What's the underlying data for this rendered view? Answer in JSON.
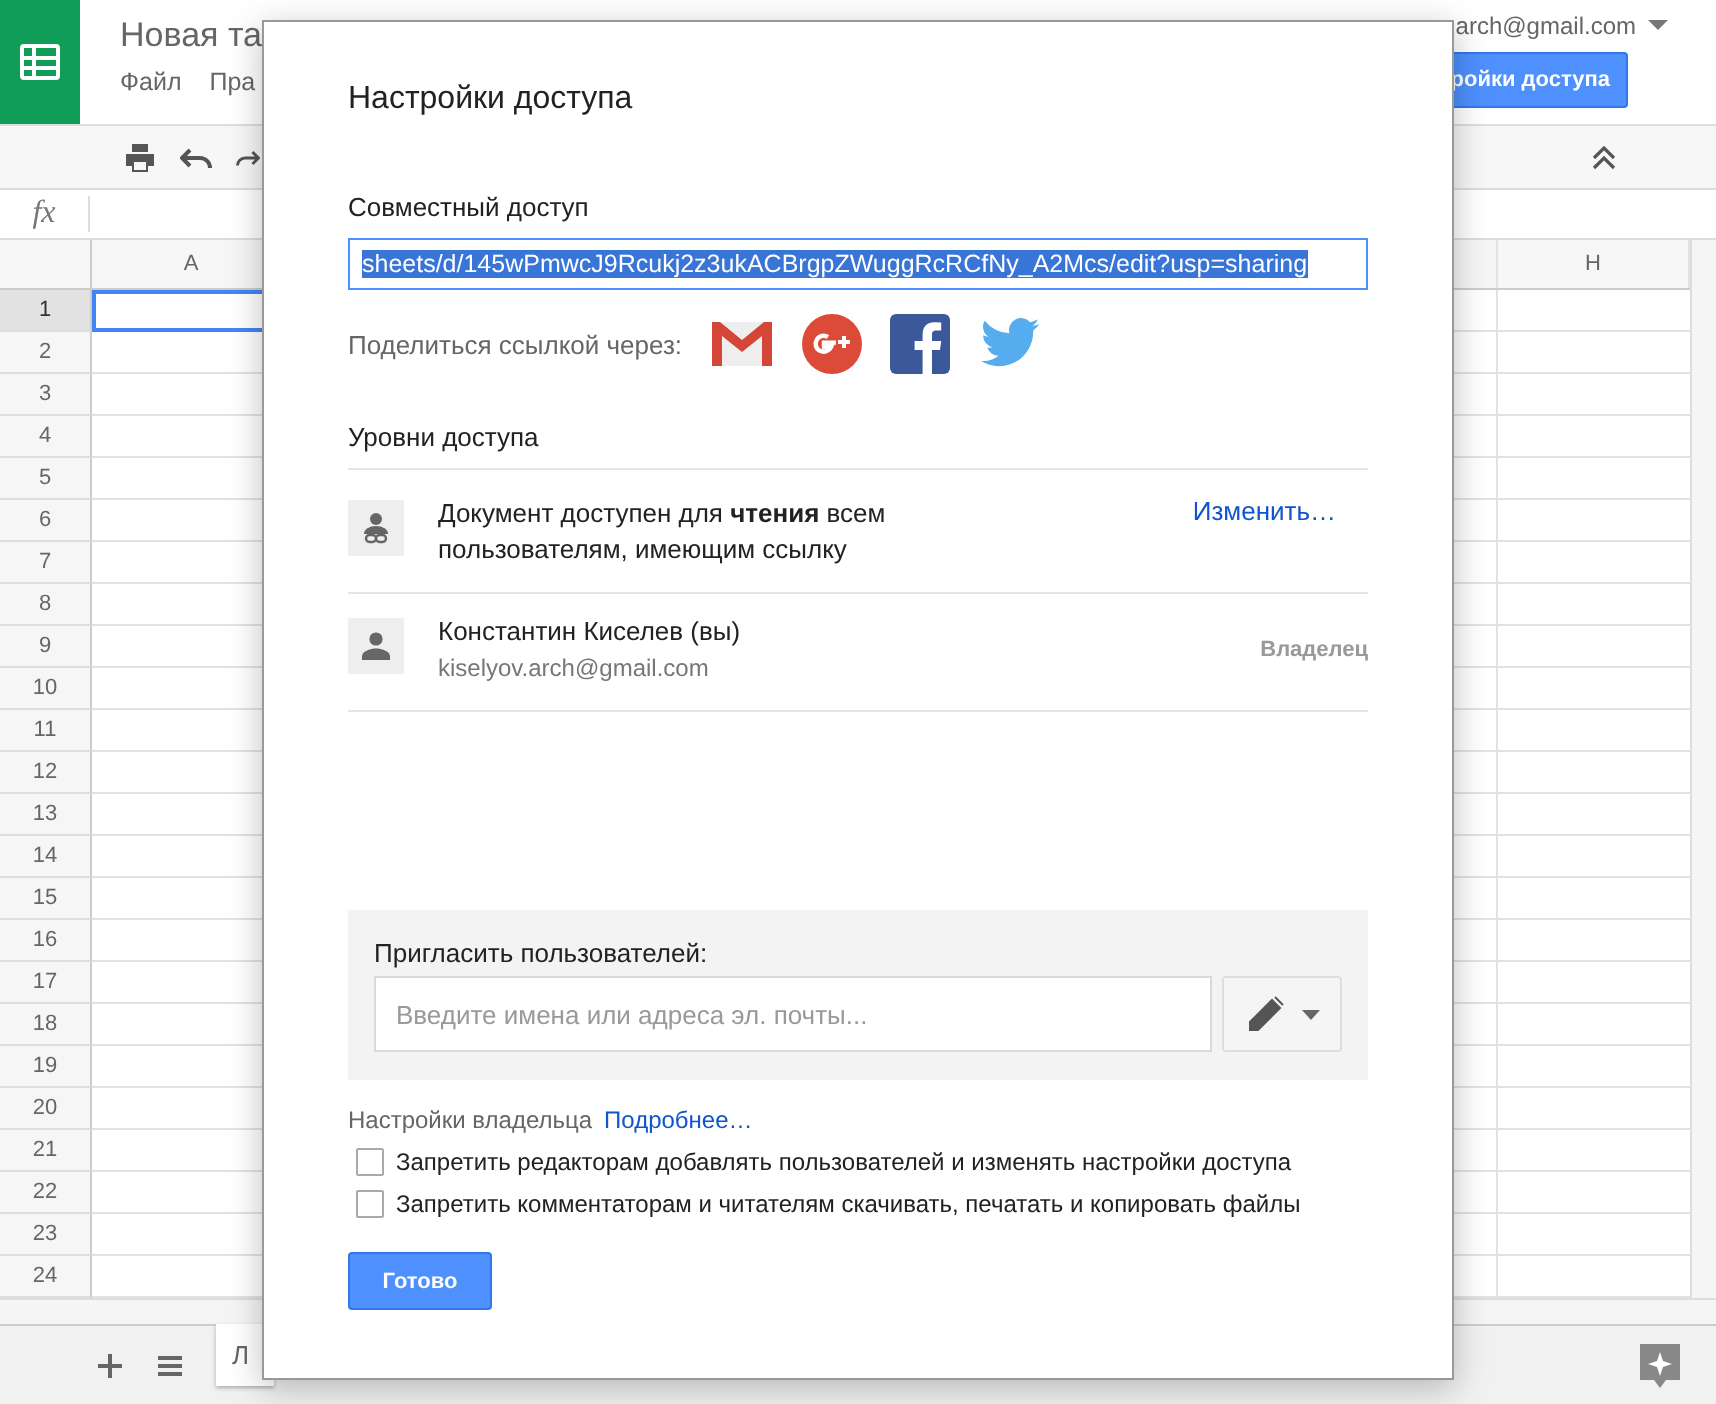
{
  "app": {
    "doc_title": "Новая та",
    "menu": [
      "Файл",
      "Пра"
    ],
    "account": "arch@gmail.com",
    "share_button": "ройки доступа",
    "formula_label": "fx",
    "columns": [
      "A",
      "H"
    ],
    "rows": [
      {
        "label": "1",
        "selected": true
      },
      {
        "label": "2",
        "selected": false
      },
      {
        "label": "3",
        "selected": false
      },
      {
        "label": "4",
        "selected": false
      },
      {
        "label": "5",
        "selected": false
      },
      {
        "label": "6",
        "selected": false
      },
      {
        "label": "7",
        "selected": false
      },
      {
        "label": "8",
        "selected": false
      },
      {
        "label": "9",
        "selected": false
      },
      {
        "label": "10",
        "selected": false
      },
      {
        "label": "11",
        "selected": false
      },
      {
        "label": "12",
        "selected": false
      },
      {
        "label": "13",
        "selected": false
      },
      {
        "label": "14",
        "selected": false
      },
      {
        "label": "15",
        "selected": false
      },
      {
        "label": "16",
        "selected": false
      },
      {
        "label": "17",
        "selected": false
      },
      {
        "label": "18",
        "selected": false
      },
      {
        "label": "19",
        "selected": false
      },
      {
        "label": "20",
        "selected": false
      },
      {
        "label": "21",
        "selected": false
      },
      {
        "label": "22",
        "selected": false
      },
      {
        "label": "23",
        "selected": false
      },
      {
        "label": "24",
        "selected": false
      }
    ],
    "sheet_tab": "Л"
  },
  "dialog": {
    "title": "Настройки доступа",
    "share_section": "Совместный доступ",
    "link": "sheets/d/145wPmwcJ9Rcukj2z3ukACBrgpZWuggRcRCfNy_A2Mcs/edit?usp=sharing",
    "share_via": "Поделиться ссылкой через:",
    "access_heading": "Уровни доступа",
    "entries": [
      {
        "kind": "link",
        "text": "Документ доступен для **чтения** всем пользователям, имеющим ссылку",
        "action": "Изменить…"
      },
      {
        "kind": "person",
        "name": "Константин Киселев (вы)",
        "email": "kiselyov.arch@gmail.com",
        "role": "Владелец"
      }
    ],
    "invite": {
      "label": "Пригласить пользователей:",
      "placeholder": "Введите имена или адреса эл. почты..."
    },
    "owner_settings": {
      "label": "Настройки владельца",
      "link": "Подробнее…"
    },
    "options": [
      {
        "label": "Запретить редакторам добавлять пользователей и изменять настройки доступа",
        "checked": false
      },
      {
        "label": "Запретить комментаторам и читателям скачивать, печатать и копировать файлы",
        "checked": false
      }
    ],
    "done": "Готово"
  }
}
